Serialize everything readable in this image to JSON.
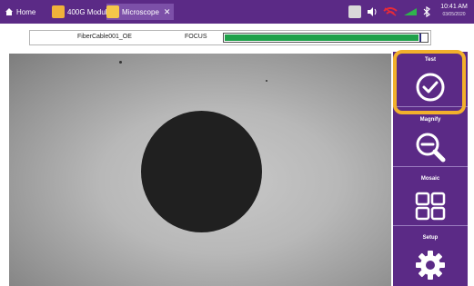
{
  "topbar": {
    "tabs": [
      {
        "label": "Home",
        "icon": "home-icon"
      },
      {
        "label": "400G Module",
        "icon": "module-icon"
      },
      {
        "label": "Microscope",
        "icon": "microscope-icon",
        "active": true
      }
    ],
    "status": {
      "time": "10:41 AM",
      "date": "03/05/2020"
    }
  },
  "focus": {
    "file_name": "FiberCable001_OE",
    "label": "FOCUS",
    "level": 0.96
  },
  "side_buttons": [
    {
      "label": "Test",
      "icon": "check-circle-icon"
    },
    {
      "label": "Magnify",
      "icon": "magnify-icon"
    },
    {
      "label": "Mosaic",
      "icon": "mosaic-icon"
    },
    {
      "label": "Setup",
      "icon": "gear-icon"
    }
  ],
  "colors": {
    "brand": "#5b2a86",
    "highlight": "#f2b02c",
    "focus_fill": "#1fa14a"
  }
}
